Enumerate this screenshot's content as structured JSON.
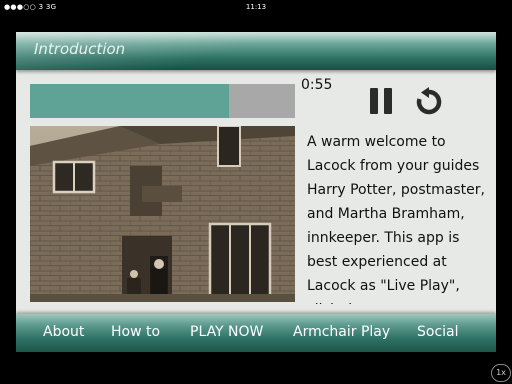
{
  "status_bar": {
    "carrier": "●●●○○ 3  3G",
    "time": "11:13"
  },
  "header": {
    "title": "Introduction"
  },
  "player": {
    "elapsed": "0:55",
    "progress_fraction": 0.75,
    "pause_icon": "pause-icon",
    "replay_icon": "replay-icon"
  },
  "photo": {
    "subject": "old stone building with figures at doorway"
  },
  "intro_text": "A warm welcome to Lacock from your guides Harry Potter, postmaster, and Martha Bramham, innkeeper. This app is best experienced at Lacock as \"Live Play\", click the",
  "tabs": [
    {
      "label": "About"
    },
    {
      "label": "How to"
    },
    {
      "label": "PLAY NOW"
    },
    {
      "label": "Armchair Play"
    },
    {
      "label": "Social"
    }
  ],
  "zoom": "1x",
  "colors": {
    "accent": "#5fa396",
    "track": "#a8a8a8",
    "bar_dark": "#1c5649"
  }
}
